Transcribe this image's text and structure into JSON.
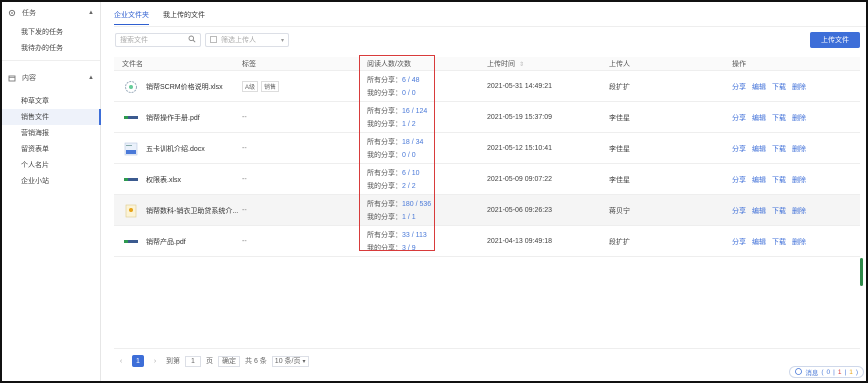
{
  "sidebar": {
    "groups": [
      {
        "label": "任务",
        "items": [
          "我下发的任务",
          "我待办的任务"
        ]
      },
      {
        "label": "内容",
        "items": [
          "种草文章",
          "销售文件",
          "营销海报",
          "留资表单",
          "个人名片",
          "企业小站"
        ]
      }
    ]
  },
  "tabs": [
    "企业文件夹",
    "我上传的文件"
  ],
  "toolbar": {
    "search_placeholder": "搜索文件",
    "filter_placeholder": "筛选上传人",
    "upload_label": "上传文件"
  },
  "table": {
    "headers": [
      "文件名",
      "标签",
      "阅读人数/次数",
      "上传时间",
      "上传人",
      "操作"
    ],
    "rows": [
      {
        "name": "销帮SCRM价格说明.xlsx",
        "tags": [
          "A级",
          "销售"
        ],
        "title": "",
        "all_label": "所有分享：",
        "all": "6 / 48",
        "my_label": "我的分享：",
        "my": "0 / 0",
        "time": "2021-05-31 14:49:21",
        "uploader": "段扩扩"
      },
      {
        "name": "销帮操作手册.pdf",
        "tags": [],
        "title": "--",
        "all_label": "所有分享：",
        "all": "16 / 124",
        "my_label": "我的分享：",
        "my": "1 / 2",
        "time": "2021-05-19 15:37:09",
        "uploader": "李佳星"
      },
      {
        "name": "五卡训机介绍.docx",
        "tags": [],
        "title": "--",
        "all_label": "所有分享：",
        "all": "18 / 34",
        "my_label": "我的分享：",
        "my": "0 / 0",
        "time": "2021-05-12 15:10:41",
        "uploader": "李佳星"
      },
      {
        "name": "权限表.xlsx",
        "tags": [],
        "title": "--",
        "all_label": "所有分享：",
        "all": "6 / 10",
        "my_label": "我的分享：",
        "my": "2 / 2",
        "time": "2021-05-09 09:07:22",
        "uploader": "李佳星"
      },
      {
        "name": "销帮数科-销衣卫助贷系统介...",
        "tags": [],
        "title": "--",
        "all_label": "所有分享：",
        "all": "180 / 536",
        "my_label": "我的分享：",
        "my": "1 / 1",
        "time": "2021-05-06 09:26:23",
        "uploader": "蒋贝宁"
      },
      {
        "name": "销帮产品.pdf",
        "tags": [],
        "title": "--",
        "all_label": "所有分享：",
        "all": "33 / 113",
        "my_label": "我的分享：",
        "my": "3 / 9",
        "time": "2021-04-13 09:49:18",
        "uploader": "段扩扩"
      }
    ],
    "ops": [
      "分享",
      "编辑",
      "下载",
      "删除"
    ]
  },
  "pager": {
    "current": "1",
    "goto_label": "到第",
    "goto_value": "1",
    "page_unit": "页",
    "go_label": "确定",
    "total": "共 6 条",
    "page_size": "10 条/页"
  },
  "message": {
    "label": "消息",
    "a": "0",
    "b": "1",
    "c": "1"
  },
  "colors": {
    "accent": "#3d6ed8",
    "highlight_box": "#d83b3b"
  }
}
